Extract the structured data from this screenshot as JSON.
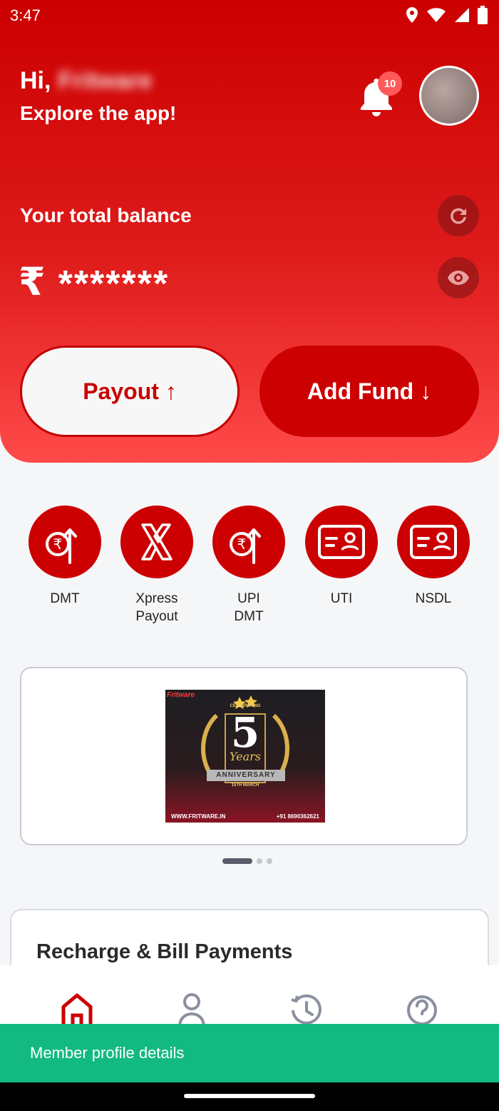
{
  "status_bar": {
    "time": "3:47",
    "icons": [
      "location-icon",
      "wifi-icon",
      "signal-icon",
      "battery-icon"
    ]
  },
  "header": {
    "greeting": "Hi,",
    "user_name": "Fritware",
    "subtitle": "Explore the app!",
    "notification_count": "10"
  },
  "balance": {
    "label": "Your total balance",
    "currency_symbol": "₹",
    "masked_value": "*******"
  },
  "actions": {
    "payout_label": "Payout ↑",
    "add_fund_label": "Add Fund ↓"
  },
  "services": [
    {
      "label": "DMT",
      "icon": "rupee-transfer-icon"
    },
    {
      "label": "Xpress\nPayout",
      "icon": "xpress-payout-icon"
    },
    {
      "label": "UPI\nDMT",
      "icon": "rupee-transfer-icon"
    },
    {
      "label": "UTI",
      "icon": "id-card-icon"
    },
    {
      "label": "NSDL",
      "icon": "id-card-icon"
    }
  ],
  "banner": {
    "brand": "Fritware",
    "celebrating": "CELEBRATING",
    "number": "5",
    "years": "Years",
    "ribbon": "ANNIVERSARY",
    "date": "15TH MARCH",
    "website": "WWW.FRITWARE.IN",
    "phone": "+91 8690362621",
    "slides_total": 3,
    "active_slide": 1
  },
  "recharge": {
    "title": "Recharge & Bill Payments"
  },
  "bottom_nav": [
    "home-icon",
    "profile-icon",
    "history-icon",
    "help-icon"
  ],
  "toast": {
    "message": "Member profile details"
  },
  "colors": {
    "brand_red": "#cc0000",
    "toast_green": "#12b981"
  }
}
